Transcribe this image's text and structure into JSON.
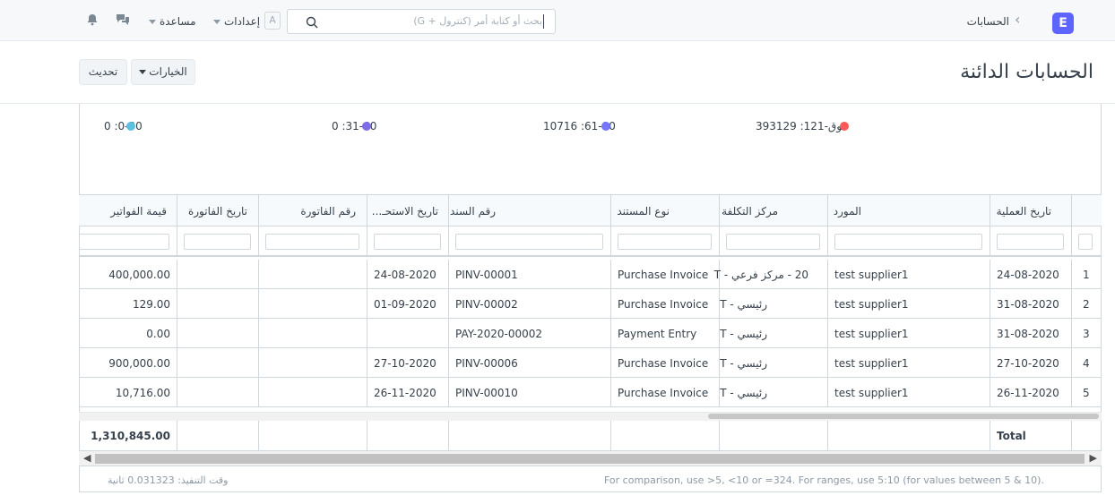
{
  "navbar": {
    "logo_letter": "E",
    "breadcrumb": "الحسابات",
    "search_placeholder": "بحث أو كتابة أمر (كنترول + G)",
    "a_label": "A",
    "settings_label": "إعدادات",
    "help_label": "مساعدة"
  },
  "page": {
    "title": "الحسابات الدائنة",
    "options_label": "الخيارات",
    "refresh_label": "تحديث"
  },
  "summary": [
    {
      "text": "393129 :فوق-121",
      "color": "#ff5858"
    },
    {
      "text": "10716 :61-90",
      "color": "#7575ff"
    },
    {
      "text": "0 :31-60",
      "color": "#7f6be8"
    },
    {
      "text": "0 :0-30",
      "color": "#5bc0de"
    }
  ],
  "columns": {
    "posting_date": "تاريخ العملية",
    "supplier": "المورد",
    "cost_center": "مركز التكلفة",
    "voucher_type": "نوع المستند",
    "voucher_no": "رقم السند",
    "due_date": "تاريخ الاستحـ...",
    "bill_no": "رقم الفاتورة",
    "bill_date": "تاريخ الفاتورة",
    "invoiced": "قيمة الفواتير"
  },
  "rows": [
    {
      "idx": "1",
      "posting_date": "24-08-2020",
      "supplier": "test supplier1",
      "cost_center": "20 - مركز فرعي - T",
      "voucher_type": "Purchase Invoice",
      "voucher_no": "PINV-00001",
      "due_date": "24-08-2020",
      "bill_no": "",
      "bill_date": "",
      "invoiced": "400,000.00"
    },
    {
      "idx": "2",
      "posting_date": "31-08-2020",
      "supplier": "test supplier1",
      "cost_center": "رئيسي - T",
      "voucher_type": "Purchase Invoice",
      "voucher_no": "PINV-00002",
      "due_date": "01-09-2020",
      "bill_no": "",
      "bill_date": "",
      "invoiced": "129.00"
    },
    {
      "idx": "3",
      "posting_date": "31-08-2020",
      "supplier": "test supplier1",
      "cost_center": "رئيسي - T",
      "voucher_type": "Payment Entry",
      "voucher_no": "PAY-2020-00002",
      "due_date": "",
      "bill_no": "",
      "bill_date": "",
      "invoiced": "0.00"
    },
    {
      "idx": "4",
      "posting_date": "27-10-2020",
      "supplier": "test supplier1",
      "cost_center": "رئيسي - T",
      "voucher_type": "Purchase Invoice",
      "voucher_no": "PINV-00006",
      "due_date": "27-10-2020",
      "bill_no": "",
      "bill_date": "",
      "invoiced": "900,000.00"
    },
    {
      "idx": "5",
      "posting_date": "26-11-2020",
      "supplier": "test supplier1",
      "cost_center": "رئيسي - T",
      "voucher_type": "Purchase Invoice",
      "voucher_no": "PINV-00010",
      "due_date": "26-11-2020",
      "bill_no": "",
      "bill_date": "",
      "invoiced": "10,716.00"
    }
  ],
  "total": {
    "label": "Total",
    "invoiced": "1,310,845.00"
  },
  "footer": {
    "exec_time": "وقت التنفيذ: 0.031323 ثانية",
    "hint": "For comparison, use >5, <10 or =324. For ranges, use 5:10 (for values between 5 & 10)."
  }
}
